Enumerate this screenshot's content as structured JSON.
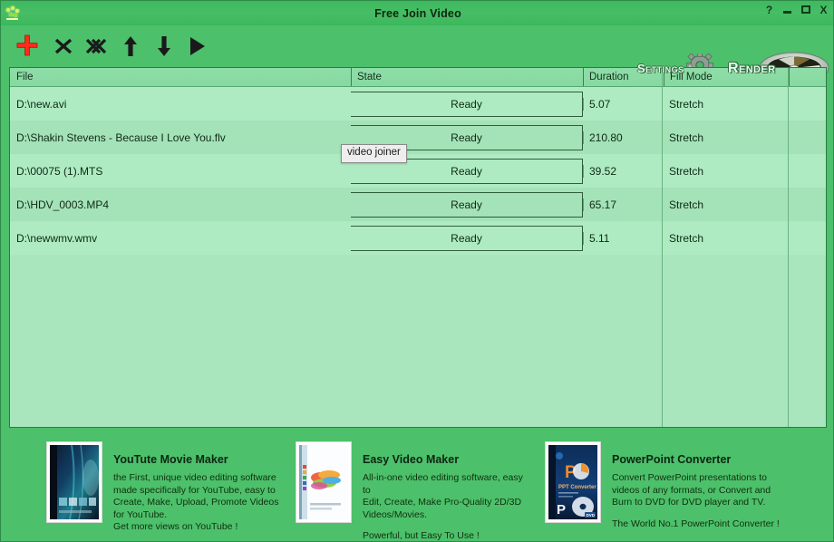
{
  "window": {
    "title": "Free Join Video",
    "app_icon": "fireworks-icon",
    "controls": [
      {
        "name": "help-button",
        "glyph": "?"
      },
      {
        "name": "minimize-button",
        "glyph": ""
      },
      {
        "name": "maximize-button",
        "glyph": ""
      },
      {
        "name": "close-button",
        "glyph": "X"
      }
    ],
    "bg_color": "#4cc06a",
    "titlebar_color": "#43bb63"
  },
  "toolbar": {
    "tools": [
      {
        "name": "add-file-icon",
        "label": "Add",
        "color": "#ff2a1e"
      },
      {
        "name": "remove-file-icon",
        "label": "Remove",
        "color": "#1a1a1a"
      },
      {
        "name": "remove-all-files-icon",
        "label": "Remove All",
        "color": "#1a1a1a"
      },
      {
        "name": "move-up-icon",
        "label": "Move Up",
        "color": "#1a1a1a"
      },
      {
        "name": "move-down-icon",
        "label": "Move Down",
        "color": "#1a1a1a"
      },
      {
        "name": "play-icon",
        "label": "Play",
        "color": "#1a1a1a"
      }
    ],
    "settings_label": "Settings",
    "render_label": "Render"
  },
  "list": {
    "columns": [
      "File",
      "State",
      "Duration",
      "Fill Mode",
      ""
    ],
    "rows": [
      {
        "file": "D:\\new.avi",
        "state": "Ready",
        "duration": "5.07",
        "fill_mode": "Stretch"
      },
      {
        "file": "D:\\Shakin Stevens - Because I Love You.flv",
        "state": "Ready",
        "duration": "210.80",
        "fill_mode": "Stretch"
      },
      {
        "file": "D:\\00075 (1).MTS",
        "state": "Ready",
        "duration": "39.52",
        "fill_mode": "Stretch"
      },
      {
        "file": "D:\\HDV_0003.MP4",
        "state": "Ready",
        "duration": "65.17",
        "fill_mode": "Stretch"
      },
      {
        "file": "D:\\newwmv.wmv",
        "state": "Ready",
        "duration": "5.11",
        "fill_mode": "Stretch"
      }
    ],
    "bg_color": "#a9e6bd"
  },
  "tooltip": {
    "text": "video joiner"
  },
  "promos": [
    {
      "name": "youtube-movie-maker",
      "title": "YouTute Movie Maker",
      "desc": "the First, unique video editing software\nmade specifically for YouTube, easy to\nCreate, Make, Upload, Promote Videos\nfor YouTube.",
      "tagline": "Get more views on YouTube !"
    },
    {
      "name": "easy-video-maker",
      "title": "Easy Video Maker",
      "desc": "All-in-one video editing software, easy to\nEdit, Create, Make Pro-Quality 2D/3D\nVideos/Movies.",
      "tagline": "Powerful, but Easy To Use !"
    },
    {
      "name": "powerpoint-converter",
      "title": "PowerPoint Converter",
      "desc": "Convert PowerPoint presentations to\nvideos of any formats, or Convert and\nBurn to DVD for DVD player and TV.",
      "tagline": "The World No.1 PowerPoint Converter !"
    }
  ]
}
